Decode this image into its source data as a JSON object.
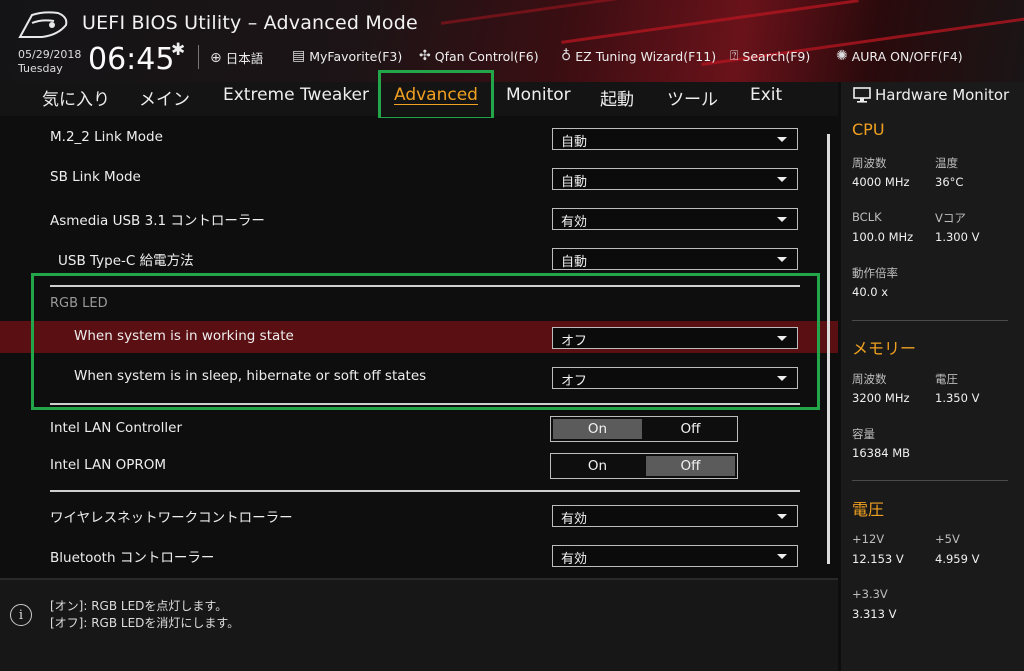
{
  "header": {
    "title": "UEFI BIOS Utility – Advanced Mode",
    "date": "05/29/2018",
    "day": "Tuesday",
    "time": "06:45",
    "menu": {
      "language": "日本語",
      "myfavorite": "MyFavorite(F3)",
      "qfan": "Qfan Control(F6)",
      "eztuning": "EZ Tuning Wizard(F11)",
      "search": "Search(F9)",
      "aura": "AURA ON/OFF(F4)"
    }
  },
  "tabs": {
    "favorites": "気に入り",
    "main": "メイン",
    "tweaker": "Extreme Tweaker",
    "advanced": "Advanced",
    "monitor": "Monitor",
    "boot": "起動",
    "tool": "ツール",
    "exit": "Exit"
  },
  "settings": {
    "m2_link": {
      "label": "M.2_2 Link Mode",
      "value": "自動"
    },
    "sb_link": {
      "label": "SB Link Mode",
      "value": "自動"
    },
    "asmedia": {
      "label": "Asmedia USB 3.1 コントローラー",
      "value": "有効"
    },
    "typec": {
      "label": "USB Type-C 給電方法",
      "value": "自動"
    },
    "rgb_section": "RGB LED",
    "rgb_working": {
      "label": "When system is in working state",
      "value": "オフ"
    },
    "rgb_sleep": {
      "label": "When system is in sleep, hibernate or soft off states",
      "value": "オフ"
    },
    "lan_controller": {
      "label": "Intel LAN Controller",
      "on": "On",
      "off": "Off",
      "selected": "On"
    },
    "lan_oprom": {
      "label": "Intel LAN OPROM",
      "on": "On",
      "off": "Off",
      "selected": "Off"
    },
    "wireless": {
      "label": "ワイヤレスネットワークコントローラー",
      "value": "有効"
    },
    "bluetooth": {
      "label": "Bluetooth コントローラー",
      "value": "有効"
    }
  },
  "help": {
    "line1": "[オン]: RGB LEDを点灯します。",
    "line2": "[オフ]: RGB LEDを消灯にします。"
  },
  "hardware_monitor": {
    "title": "Hardware Monitor",
    "cpu": {
      "heading": "CPU",
      "freq_label": "周波数",
      "freq": "4000 MHz",
      "temp_label": "温度",
      "temp": "36°C",
      "bclk_label": "BCLK",
      "bclk": "100.0 MHz",
      "vcore_label": "Vコア",
      "vcore": "1.300 V",
      "ratio_label": "動作倍率",
      "ratio": "40.0 x"
    },
    "memory": {
      "heading": "メモリー",
      "freq_label": "周波数",
      "freq": "3200 MHz",
      "volt_label": "電圧",
      "volt": "1.350 V",
      "cap_label": "容量",
      "cap": "16384 MB"
    },
    "voltage": {
      "heading": "電圧",
      "v12_label": "+12V",
      "v12": "12.153 V",
      "v5_label": "+5V",
      "v5": "4.959 V",
      "v33_label": "+3.3V",
      "v33": "3.313 V"
    }
  },
  "colors": {
    "accent": "#f0a020",
    "highlight_box": "#23a64a",
    "selected_row": "#5a0f12"
  }
}
